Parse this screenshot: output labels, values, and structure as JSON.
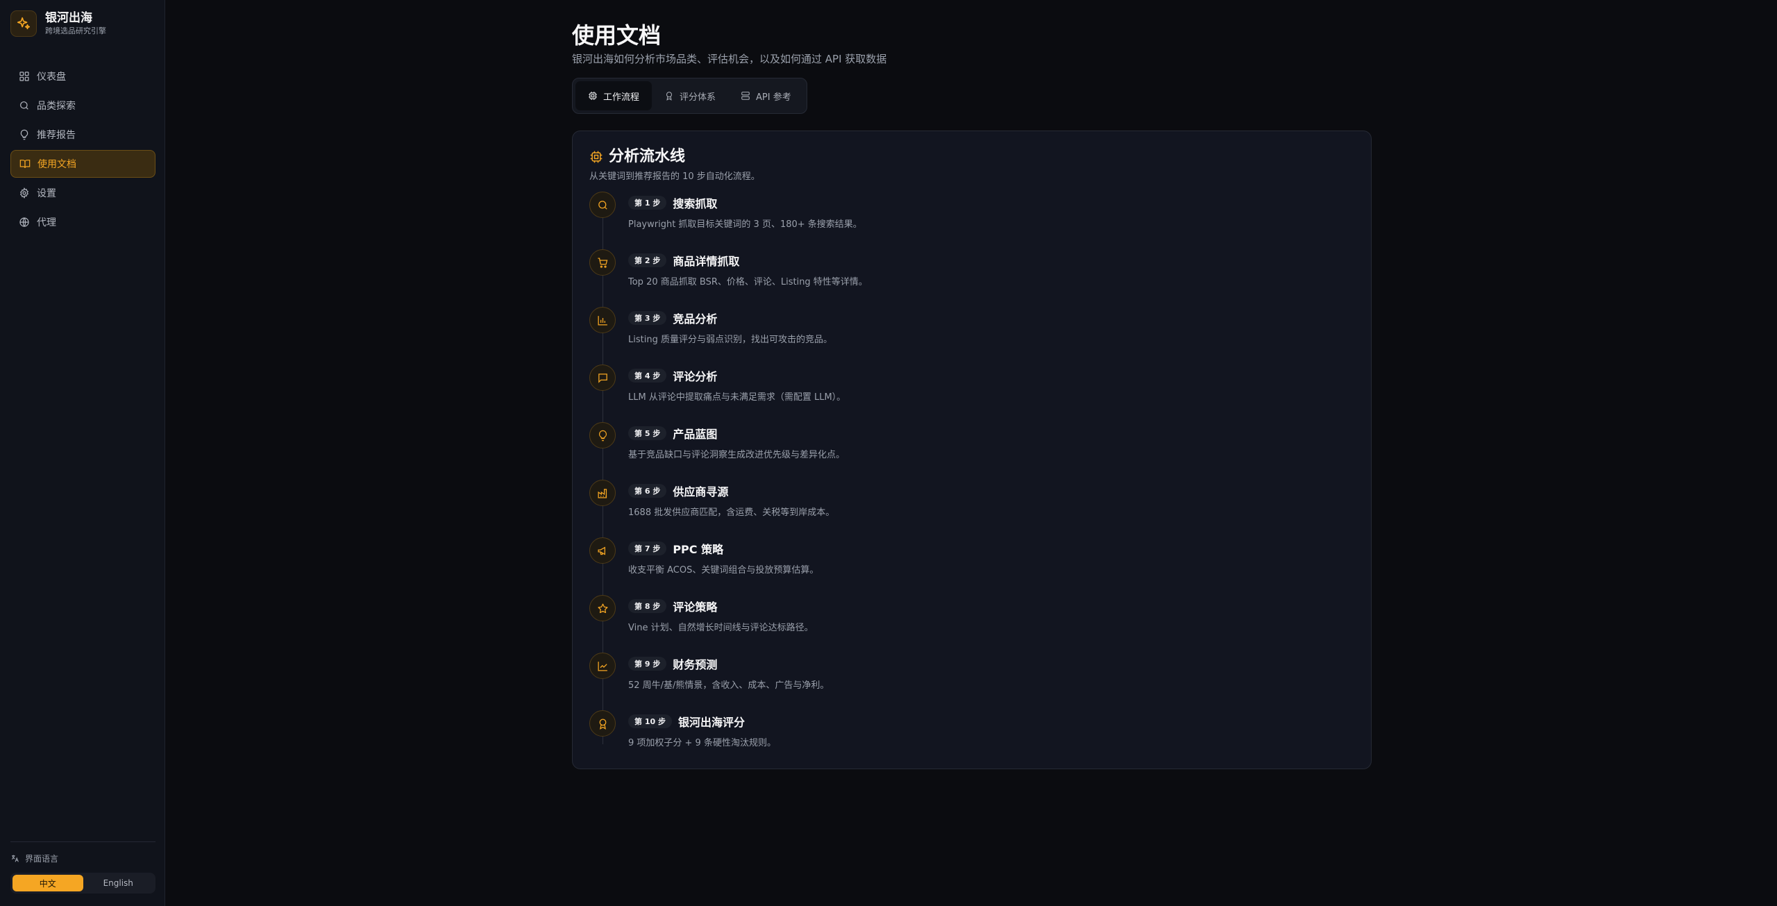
{
  "brand": {
    "name": "银河出海",
    "subtitle": "跨境选品研究引擎"
  },
  "nav": [
    {
      "label": "仪表盘",
      "icon": "dashboard-icon"
    },
    {
      "label": "品类探索",
      "icon": "search-icon"
    },
    {
      "label": "推荐报告",
      "icon": "lightbulb-icon"
    },
    {
      "label": "使用文档",
      "icon": "book-icon",
      "active": true
    },
    {
      "label": "设置",
      "icon": "gear-icon"
    },
    {
      "label": "代理",
      "icon": "globe-icon"
    }
  ],
  "language": {
    "label": "界面语言",
    "options": [
      "中文",
      "English"
    ],
    "selected": "中文"
  },
  "page": {
    "title": "使用文档",
    "subtitle": "银河出海如何分析市场品类、评估机会，以及如何通过 API 获取数据"
  },
  "tabs": [
    {
      "label": "工作流程",
      "icon": "cpu-icon",
      "active": true
    },
    {
      "label": "评分体系",
      "icon": "award-icon"
    },
    {
      "label": "API 参考",
      "icon": "server-icon"
    }
  ],
  "pipeline": {
    "title": "分析流水线",
    "subtitle": "从关键词到推荐报告的 10 步自动化流程。",
    "steps": [
      {
        "badge": "第 1 步",
        "title": "搜索抓取",
        "desc": "Playwright 抓取目标关键词的 3 页、180+ 条搜索结果。",
        "icon": "search-icon"
      },
      {
        "badge": "第 2 步",
        "title": "商品详情抓取",
        "desc": "Top 20 商品抓取 BSR、价格、评论、Listing 特性等详情。",
        "icon": "cart-icon"
      },
      {
        "badge": "第 3 步",
        "title": "竞品分析",
        "desc": "Listing 质量评分与弱点识别，找出可攻击的竞品。",
        "icon": "bar-chart-icon"
      },
      {
        "badge": "第 4 步",
        "title": "评论分析",
        "desc": "LLM 从评论中提取痛点与未满足需求（需配置 LLM）。",
        "icon": "message-icon"
      },
      {
        "badge": "第 5 步",
        "title": "产品蓝图",
        "desc": "基于竞品缺口与评论洞察生成改进优先级与差异化点。",
        "icon": "lightbulb-icon"
      },
      {
        "badge": "第 6 步",
        "title": "供应商寻源",
        "desc": "1688 批发供应商匹配，含运费、关税等到岸成本。",
        "icon": "factory-icon"
      },
      {
        "badge": "第 7 步",
        "title": "PPC 策略",
        "desc": "收支平衡 ACOS、关键词组合与投放预算估算。",
        "icon": "megaphone-icon"
      },
      {
        "badge": "第 8 步",
        "title": "评论策略",
        "desc": "Vine 计划、自然增长时间线与评论达标路径。",
        "icon": "star-icon"
      },
      {
        "badge": "第 9 步",
        "title": "财务预测",
        "desc": "52 周牛/基/熊情景，含收入、成本、广告与净利。",
        "icon": "line-chart-icon"
      },
      {
        "badge": "第 10 步",
        "title": "银河出海评分",
        "desc": "9 项加权子分 + 9 条硬性淘汰规则。",
        "icon": "award-icon"
      }
    ]
  },
  "colors": {
    "accent": "#f5a623",
    "background": "#0b0c10",
    "card": "#121520"
  }
}
